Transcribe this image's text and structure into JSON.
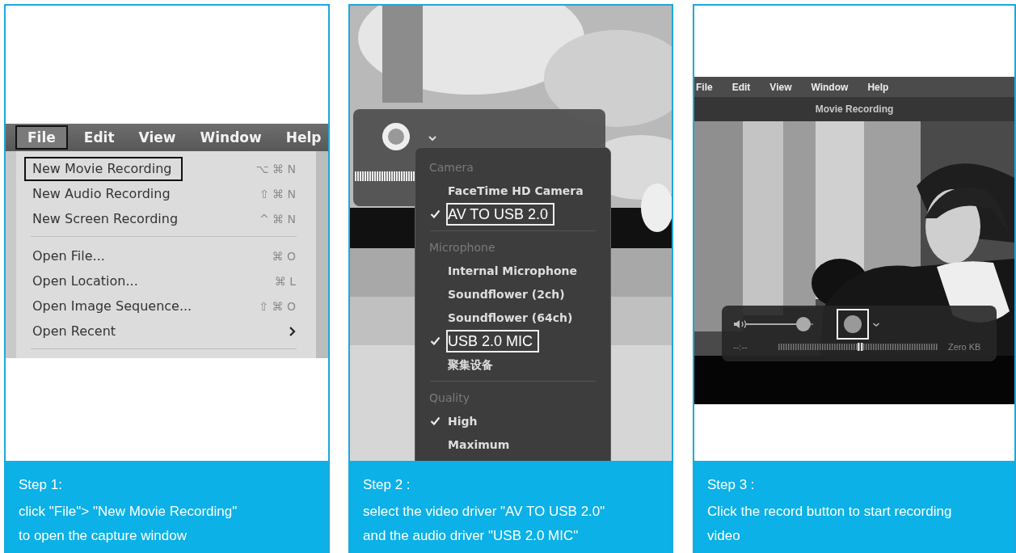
{
  "step1": {
    "menu_bar": [
      {
        "label": "File",
        "selected": true
      },
      {
        "label": "Edit",
        "selected": false
      },
      {
        "label": "View",
        "selected": false
      },
      {
        "label": "Window",
        "selected": false
      },
      {
        "label": "Help",
        "selected": false
      }
    ],
    "menu_groups": [
      [
        {
          "label": "New Movie Recording",
          "shortcut": "⌥ ⌘ N",
          "highlighted": true,
          "submenu": false
        },
        {
          "label": "New Audio Recording",
          "shortcut": "⇧ ⌘ N",
          "highlighted": false,
          "submenu": false
        },
        {
          "label": "New Screen Recording",
          "shortcut": "^ ⌘ N",
          "highlighted": false,
          "submenu": false
        }
      ],
      [
        {
          "label": "Open File...",
          "shortcut": "⌘ O",
          "highlighted": false,
          "submenu": false
        },
        {
          "label": "Open Location...",
          "shortcut": "⌘ L",
          "highlighted": false,
          "submenu": false
        },
        {
          "label": "Open Image Sequence...",
          "shortcut": "⇧ ⌘ O",
          "highlighted": false,
          "submenu": false
        },
        {
          "label": "Open Recent",
          "highlighted": false,
          "submenu": true
        }
      ]
    ],
    "caption": {
      "title": "Step 1:",
      "text": "click \"File\"> \"New Movie Recording\"\nto open the capture window"
    }
  },
  "step2": {
    "sections": [
      {
        "heading": "Camera",
        "items": [
          {
            "label": "FaceTime HD Camera",
            "checked": false,
            "highlighted": false
          },
          {
            "label": "AV TO USB 2.0",
            "checked": true,
            "highlighted": true
          }
        ]
      },
      {
        "heading": "Microphone",
        "items": [
          {
            "label": "Internal Microphone",
            "checked": false,
            "highlighted": false
          },
          {
            "label": "Soundflower (2ch)",
            "checked": false,
            "highlighted": false
          },
          {
            "label": "Soundflower (64ch)",
            "checked": false,
            "highlighted": false
          },
          {
            "label": "USB 2.0 MIC",
            "checked": true,
            "highlighted": true
          },
          {
            "label": "聚集设备",
            "checked": false,
            "highlighted": false
          }
        ]
      },
      {
        "heading": "Quality",
        "items": [
          {
            "label": "High",
            "checked": true,
            "highlighted": false
          },
          {
            "label": "Maximum",
            "checked": false,
            "highlighted": false
          }
        ]
      }
    ],
    "caption": {
      "title": "Step 2 :",
      "text": "select the video driver \"AV TO USB 2.0\"\nand the audio driver \"USB 2.0 MIC\""
    }
  },
  "step3": {
    "menu_bar": [
      "File",
      "Edit",
      "View",
      "Window",
      "Help"
    ],
    "window_title": "Movie Recording",
    "controls": {
      "volume": {
        "level": 0.95
      },
      "record_button": {
        "highlighted": true
      },
      "time": "--:--",
      "file_size": "Zero KB"
    },
    "caption": {
      "title": "Step 3 :",
      "text": "Click the record button to start recording\nvideo"
    }
  }
}
